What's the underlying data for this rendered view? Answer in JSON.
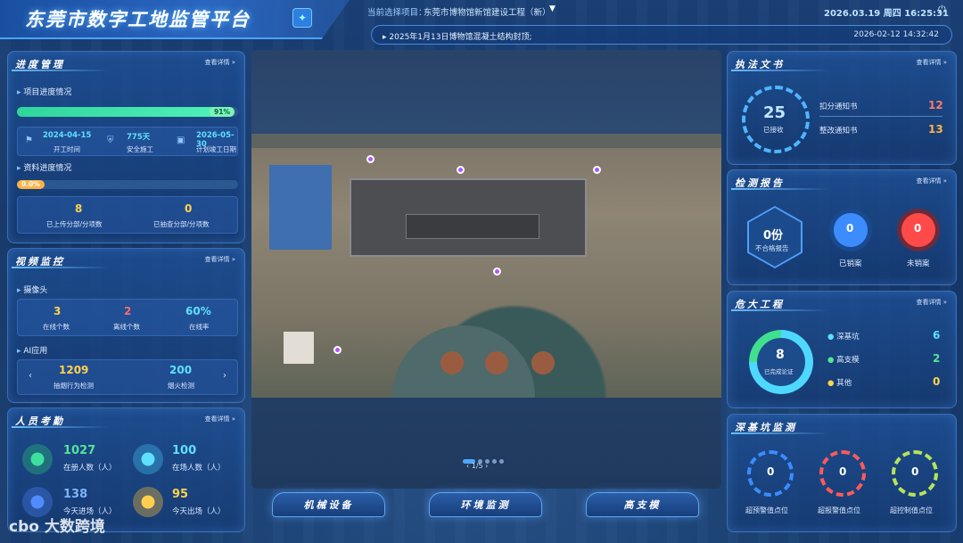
{
  "app": {
    "title": "东莞市数字工地监管平台",
    "project_label": "当前选择项目：",
    "project_name": "东莞市博物馆新馆建设工程（新）",
    "datetime": "2026.03.19 周四 16:25:31",
    "notice": "2025年1月13日博物馆混凝土结构封顶;",
    "notice_time": "2026-02-12 14:32:42"
  },
  "common": {
    "more": "查看详情 »"
  },
  "progress": {
    "title": "进度管理",
    "sub1": "项目进度情况",
    "percent_label": "91%",
    "percent": 0.91,
    "start_date": "2024-04-15",
    "start_label": "开工时间",
    "safe_days": "775天",
    "safe_label": "安全施工",
    "end_date": "2026-05-30",
    "end_label": "计划竣工日期",
    "sub2": "资料进度情况",
    "doc_percent_label": "0.0%",
    "doc_percent": 0.0,
    "uploaded": "8",
    "uploaded_label": "已上传分部/分项数",
    "checked": "0",
    "checked_label": "已抽查分部/分项数"
  },
  "video": {
    "title": "视频监控",
    "sub1": "摄像头",
    "online": "3",
    "online_label": "在线个数",
    "offline": "2",
    "offline_label": "离线个数",
    "rate": "60%",
    "rate_label": "在线率",
    "sub2": "AI应用",
    "smoke": "1209",
    "smoke_label": "抽烟行为检测",
    "fire": "200",
    "fire_label": "烟火检测"
  },
  "personnel": {
    "title": "人员考勤",
    "registered": "1027",
    "registered_label": "在册人数（人）",
    "onsite": "100",
    "onsite_label": "在场人数（人）",
    "enter": "138",
    "enter_label": "今天进场（人）",
    "exit": "95",
    "exit_label": "今天出场（人）"
  },
  "law": {
    "title": "执法文书",
    "received": "25",
    "received_label": "已接收",
    "deduct_label": "扣分通知书",
    "deduct": "12",
    "rectify_label": "整改通知书",
    "rectify": "13"
  },
  "report": {
    "title": "检测报告",
    "unqualified": "0份",
    "unqualified_label": "不合格报告",
    "closed": "0",
    "closed_label": "已销案",
    "unclosed": "0",
    "unclosed_label": "未销案"
  },
  "danger": {
    "title": "危大工程",
    "total": "8",
    "total_label": "已完成论证",
    "items": [
      {
        "label": "深基坑",
        "value": "6"
      },
      {
        "label": "高支模",
        "value": "2"
      },
      {
        "label": "其他",
        "value": "0"
      }
    ],
    "fraction": 0.75
  },
  "pit": {
    "title": "深基坑监测",
    "items": [
      {
        "value": "0",
        "label": "超预警值点位",
        "color": "#3b8cff"
      },
      {
        "value": "0",
        "label": "超报警值点位",
        "color": "#ff5a5a"
      },
      {
        "value": "0",
        "label": "超控制值点位",
        "color": "#b6e35a"
      }
    ]
  },
  "map": {
    "pager": "‹   1/5   ›"
  },
  "bottom": {
    "b1": "机械设备",
    "b2": "环境监测",
    "b3": "高支模"
  },
  "watermark": "大数跨境"
}
